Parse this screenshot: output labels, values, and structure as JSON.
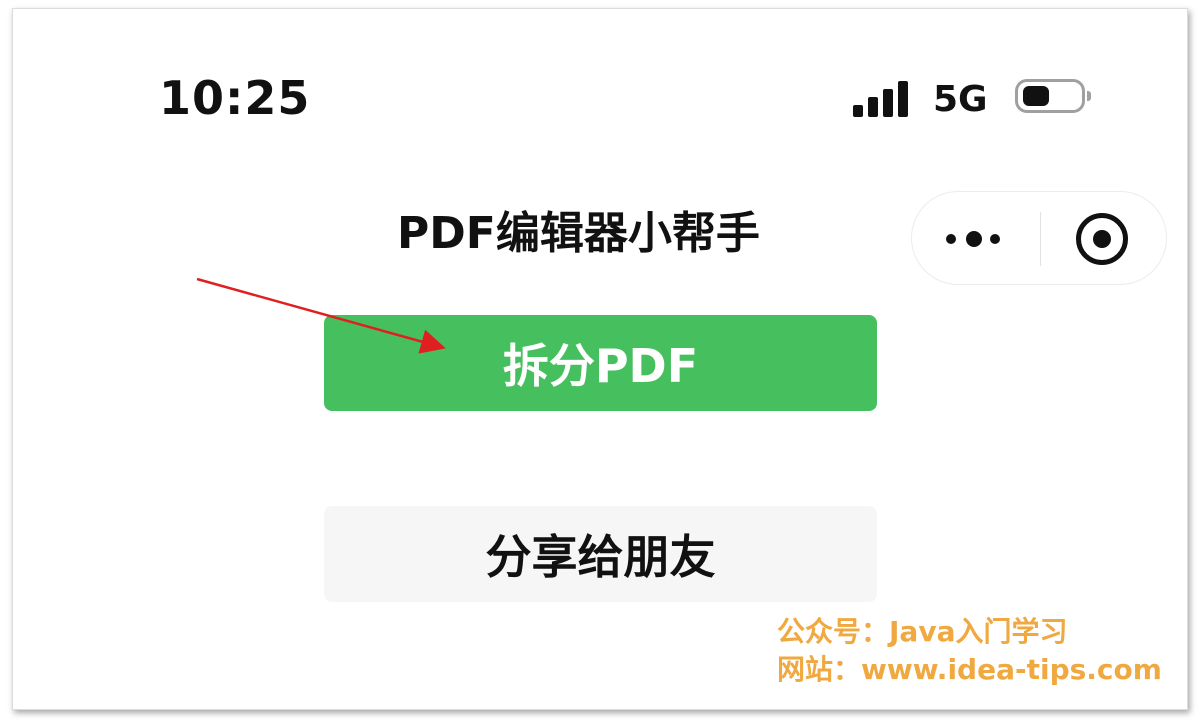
{
  "status_bar": {
    "time": "10:25",
    "network": "5G",
    "signal_icon": "signal-bars-icon",
    "battery_icon": "battery-icon"
  },
  "header": {
    "title": "PDF编辑器小帮手",
    "more_icon": "more-dots-icon",
    "close_icon": "target-close-icon"
  },
  "main": {
    "split_button_label": "拆分PDF",
    "share_button_label": "分享给朋友"
  },
  "annotation": {
    "arrow_color": "#e02020"
  },
  "watermark": {
    "line1": "公众号：Java入门学习",
    "line2": "网站：www.idea-tips.com"
  },
  "colors": {
    "primary_green": "#46c05f",
    "secondary_bg": "#f6f6f6",
    "watermark": "#f0a840"
  }
}
